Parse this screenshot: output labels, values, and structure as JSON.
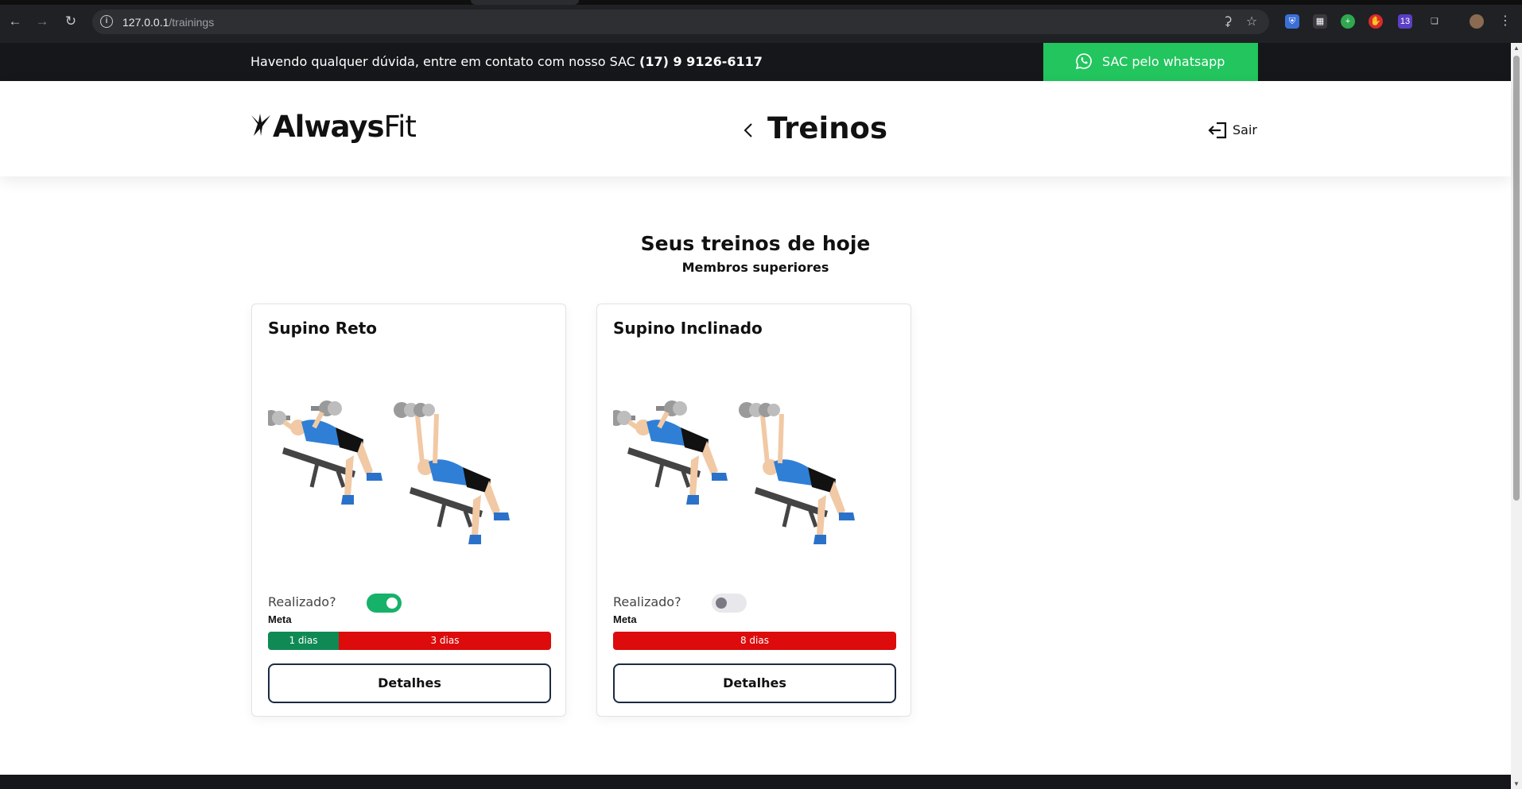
{
  "browser": {
    "url_host": "127.0.0.1",
    "url_path": "/trainings",
    "extension_badge": "13"
  },
  "topbar": {
    "message": "Havendo qualquer dúvida, entre em contato com nosso SAC ",
    "phone": "(17) 9 9126-6117",
    "whatsapp_label": "SAC pelo whatsapp",
    "whatsapp_color": "#22c55e"
  },
  "header": {
    "brand_bold": "Always",
    "brand_light": "Fit",
    "page_title": "Treinos",
    "logout_label": "Sair"
  },
  "main": {
    "title": "Seus treinos de hoje",
    "subtitle": "Membros superiores"
  },
  "cards": [
    {
      "name": "Supino Reto",
      "done_label": "Realizado?",
      "done": true,
      "meta_label": "Meta",
      "segments": [
        {
          "label": "1 dias",
          "days": 1,
          "color": "#0f8a55"
        },
        {
          "label": "3 dias",
          "days": 3,
          "color": "#dd0b0b"
        }
      ],
      "details_label": "Detalhes"
    },
    {
      "name": "Supino Inclinado",
      "done_label": "Realizado?",
      "done": false,
      "meta_label": "Meta",
      "segments": [
        {
          "label": "8 dias",
          "days": 8,
          "color": "#dd0b0b"
        }
      ],
      "details_label": "Detalhes"
    }
  ]
}
